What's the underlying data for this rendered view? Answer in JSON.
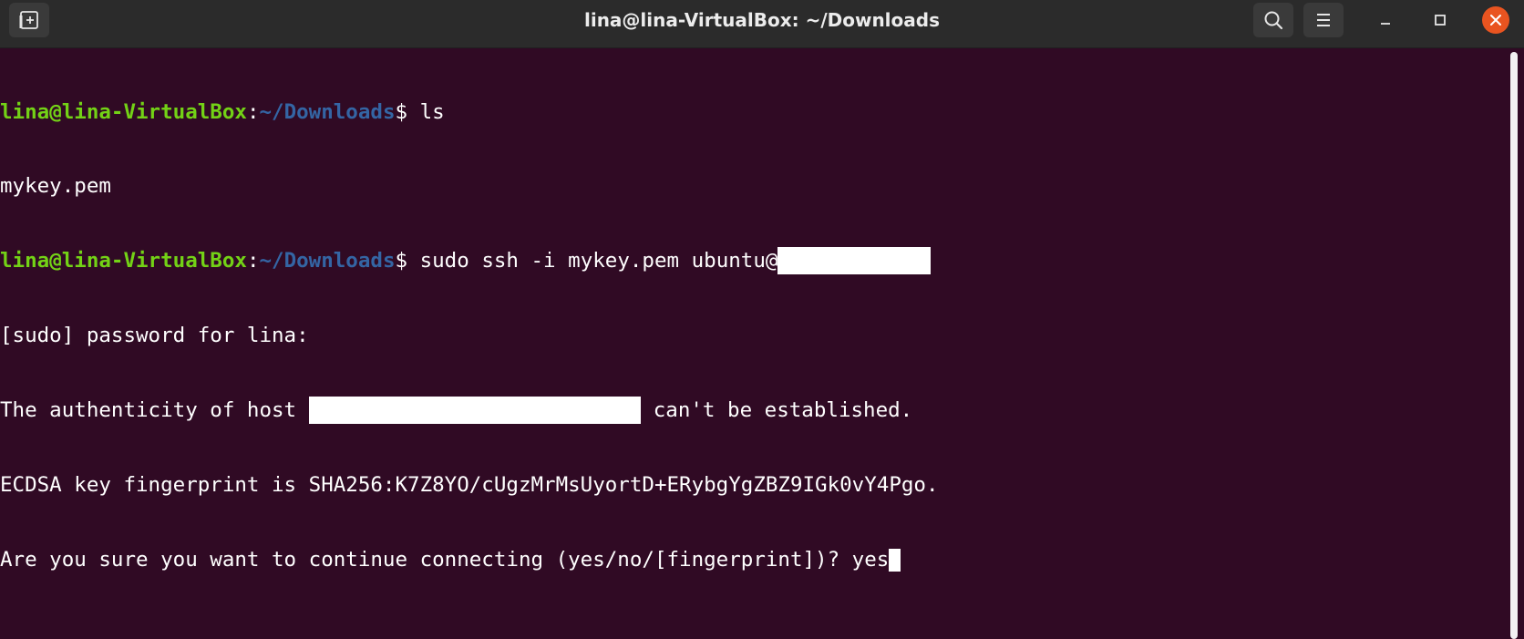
{
  "window": {
    "title": "lina@lina-VirtualBox: ~/Downloads"
  },
  "icons": {
    "new_tab": "new-tab-icon",
    "search": "search-icon",
    "menu": "hamburger-menu-icon",
    "minimize": "minimize-icon",
    "maximize": "maximize-icon",
    "close": "close-icon"
  },
  "colors": {
    "terminal_bg": "#300a24",
    "prompt_user": "#73d216",
    "prompt_path": "#3465a4",
    "close_button": "#e95420"
  },
  "terminal": {
    "lines": [
      {
        "user": "lina@lina-VirtualBox",
        "sep": ":",
        "path": "~/Downloads",
        "dollar": "$ ",
        "command": "ls"
      },
      {
        "output": "mykey.pem"
      },
      {
        "user": "lina@lina-VirtualBox",
        "sep": ":",
        "path": "~/Downloads",
        "dollar": "$ ",
        "command": "sudo ssh -i mykey.pem ubuntu@"
      },
      {
        "output": "[sudo] password for lina:"
      },
      {
        "before": "The authenticity of host '",
        "after": " can't be established."
      },
      {
        "output": "ECDSA key fingerprint is SHA256:K7Z8YO/cUgzMrMsUyortD+ERybgYgZBZ9IGk0vY4Pgo."
      },
      {
        "output": "Are you sure you want to continue connecting (yes/no/[fingerprint])? yes"
      }
    ]
  }
}
